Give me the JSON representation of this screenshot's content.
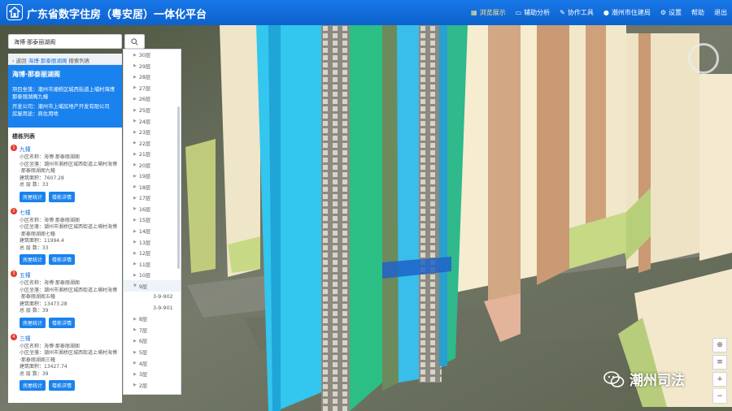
{
  "header": {
    "title": "广东省数字住房（粤安居）一体化平台",
    "nav": [
      {
        "label": "浏览展示",
        "icon": "grid-icon",
        "active": true
      },
      {
        "label": "辅助分析",
        "icon": "monitor-icon",
        "active": false
      },
      {
        "label": "协作工具",
        "icon": "tools-icon",
        "active": false
      }
    ],
    "user": "潮州市住建局",
    "settings": "设置",
    "help": "帮助",
    "logout": "退出"
  },
  "search": {
    "value": "海博·那泰丽湖阁",
    "button_icon": "search-icon"
  },
  "breadcrumb": {
    "back": "返回",
    "keyword": "海博·那泰丽湖阁",
    "suffix": "搜索列表"
  },
  "project": {
    "name": "海博·那泰丽湖阁",
    "location_label": "项目坐落：",
    "location": "潮州市湘桥区城西街道上埔村海博那泰丽湖阁九幢",
    "developer_label": "开发公司：",
    "developer": "潮州市上埔房地产开发有限公司",
    "usage_label": "房屋用途：",
    "usage": "商住用地"
  },
  "building_list_title": "楼栋列表",
  "buildings": [
    {
      "index": "1",
      "name": "九幢",
      "community": "小区名称：海博·那泰丽湖阁",
      "address": "小区坐落：潮州市湘桥区城西街道上埔村海博·那泰丽湖阁九幢",
      "area": "建筑面积：7607.28",
      "floors": "总 层 数：33",
      "btn1": "房屋统计",
      "btn2": "楼栋详情"
    },
    {
      "index": "2",
      "name": "七幢",
      "community": "小区名称：海博·那泰丽湖阁",
      "address": "小区坐落：潮州市湘桥区城西街道上埔村海博·那泰丽湖阁七幢",
      "area": "建筑面积：11994.4",
      "floors": "总 层 数：33",
      "btn1": "房屋统计",
      "btn2": "楼栋详情"
    },
    {
      "index": "3",
      "name": "五幢",
      "community": "小区名称：海博·那泰丽湖阁",
      "address": "小区坐落：潮州市湘桥区城西街道上埔村海博·那泰丽湖阁五幢",
      "area": "建筑面积：13473.28",
      "floors": "总 层 数：39",
      "btn1": "房屋统计",
      "btn2": "楼栋详情"
    },
    {
      "index": "4",
      "name": "三幢",
      "community": "小区名称：海博·那泰丽湖阁",
      "address": "小区坐落：潮州市湘桥区城西街道上埔村海博·那泰丽湖阁三幢",
      "area": "建筑面积：13427.74",
      "floors": "总 层 数：39",
      "btn1": "房屋统计",
      "btn2": "楼栋详情"
    }
  ],
  "floors_top": [
    "30层",
    "29层",
    "28层",
    "27层",
    "26层",
    "25层",
    "24层",
    "23层",
    "22层",
    "21层",
    "20层",
    "19层",
    "18层",
    "17层",
    "16层",
    "15层",
    "14层",
    "13层",
    "12层",
    "11层",
    "10层"
  ],
  "floor_open": "9层",
  "rooms": [
    "3-9-902",
    "3-9-901"
  ],
  "floors_bottom": [
    "8层",
    "7层",
    "6层",
    "5层",
    "4层",
    "3层",
    "2层"
  ],
  "watermark": "潮州司法",
  "colors": {
    "header": "#1877e8",
    "accent": "#1a82ee",
    "pin": "#e33b2e"
  }
}
